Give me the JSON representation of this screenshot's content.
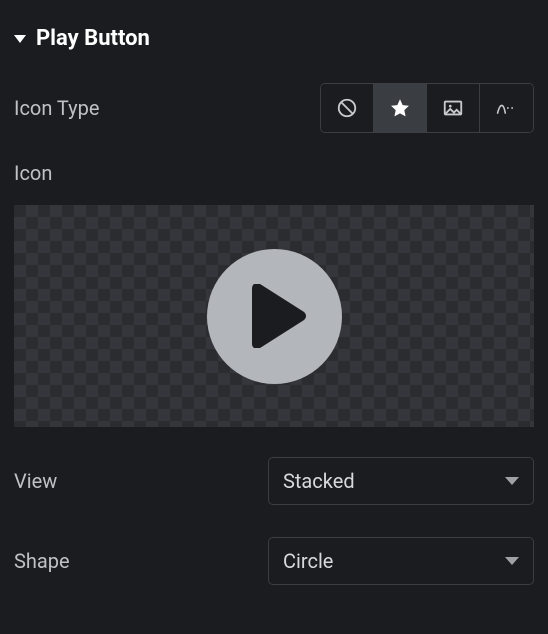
{
  "section": {
    "title": "Play Button"
  },
  "iconType": {
    "label": "Icon Type",
    "selected": "star",
    "options": [
      "none",
      "star",
      "image",
      "path"
    ]
  },
  "iconPreview": {
    "label": "Icon"
  },
  "view": {
    "label": "View",
    "value": "Stacked"
  },
  "shape": {
    "label": "Shape",
    "value": "Circle"
  },
  "colors": {
    "playFill": "#b3b6ba",
    "playInner": "#1a1c1f"
  }
}
